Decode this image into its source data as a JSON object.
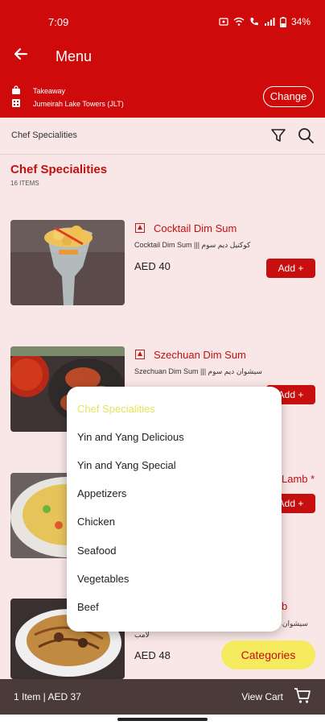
{
  "status": {
    "time": "7:09",
    "battery": "34%"
  },
  "appbar": {
    "title": "Menu"
  },
  "location": {
    "mode": "Takeaway",
    "place": "Jumeirah Lake Towers (JLT)",
    "change_label": "Change"
  },
  "catbar": {
    "label": "Chef Specialities"
  },
  "section": {
    "title": "Chef Specialities",
    "count": "16 ITEMS"
  },
  "items": [
    {
      "name": "Cocktail Dim Sum",
      "desc": "Cocktail Dim Sum ||| كوكتيل ديم سوم",
      "price": "AED 40",
      "add": "Add +"
    },
    {
      "name": "Szechuan Dim Sum",
      "desc": "Szechuan Dim Sum ||| سيشوان ديم سوم",
      "price": "",
      "add": "Add +"
    },
    {
      "name": "Lamb *",
      "desc": "",
      "price": "",
      "add": "Add +"
    },
    {
      "name": "b",
      "desc": "سيشوان لـ",
      "extra": "لامب",
      "price": "AED 48",
      "add": ""
    }
  ],
  "categories_popup": {
    "options": [
      "Chef Specialities",
      "Yin and  Yang  Delicious",
      "Yin and Yang Special",
      "Appetizers",
      "Chicken",
      "Seafood",
      "Vegetables",
      "Beef"
    ]
  },
  "categories_button": "Categories",
  "cart": {
    "info": "1 Item | AED 37",
    "view_label": "View Cart"
  },
  "colors": {
    "brand": "#cf0a0a",
    "accent": "#f6ea5e",
    "background": "#f9e6e6",
    "cart_bar": "#4a3a3a"
  }
}
